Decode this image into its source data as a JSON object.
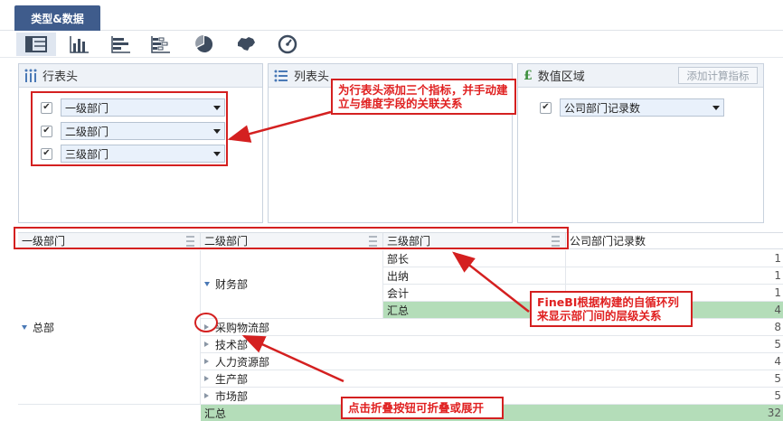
{
  "tab": {
    "label": "类型&数据"
  },
  "toolbar": {
    "icons": [
      "table-icon",
      "bar-chart-icon",
      "horizontal-bar-icon",
      "stacked-bar-icon",
      "pie-chart-icon",
      "map-icon",
      "gauge-icon"
    ]
  },
  "panels": {
    "row_header": {
      "title": "行表头",
      "fields": [
        "一级部门",
        "二级部门",
        "三级部门"
      ]
    },
    "col_header": {
      "title": "列表头"
    },
    "value_area": {
      "title": "数值区域",
      "calc_button": "添加计算指标",
      "fields": [
        "公司部门记录数"
      ]
    }
  },
  "table": {
    "headers": [
      "一级部门",
      "二级部门",
      "三级部门",
      "公司部门记录数"
    ],
    "level1": "总部",
    "finance": {
      "name": "财务部",
      "rows": [
        {
          "name": "部长",
          "value": "1"
        },
        {
          "name": "出纳",
          "value": "1"
        },
        {
          "name": "会计",
          "value": "1"
        }
      ],
      "subtotal_label": "汇总",
      "subtotal": "4"
    },
    "collapsed": [
      {
        "name": "采购物流部",
        "value": "8"
      },
      {
        "name": "技术部",
        "value": "5"
      },
      {
        "name": "人力资源部",
        "value": "4"
      },
      {
        "name": "生产部",
        "value": "5"
      },
      {
        "name": "市场部",
        "value": "5"
      }
    ],
    "total_label": "汇总",
    "total": "32"
  },
  "annotations": {
    "note1": "为行表头添加三个指标，并手动建立与维度字段的关联关系",
    "note2": "FineBI根据构建的自循环列来显示部门间的层级关系",
    "note3": "点击折叠按钮可折叠或展开"
  },
  "colors": {
    "accent": "#3f5c8c",
    "annotation": "#d42020",
    "total_row": "#b4ddb9"
  }
}
